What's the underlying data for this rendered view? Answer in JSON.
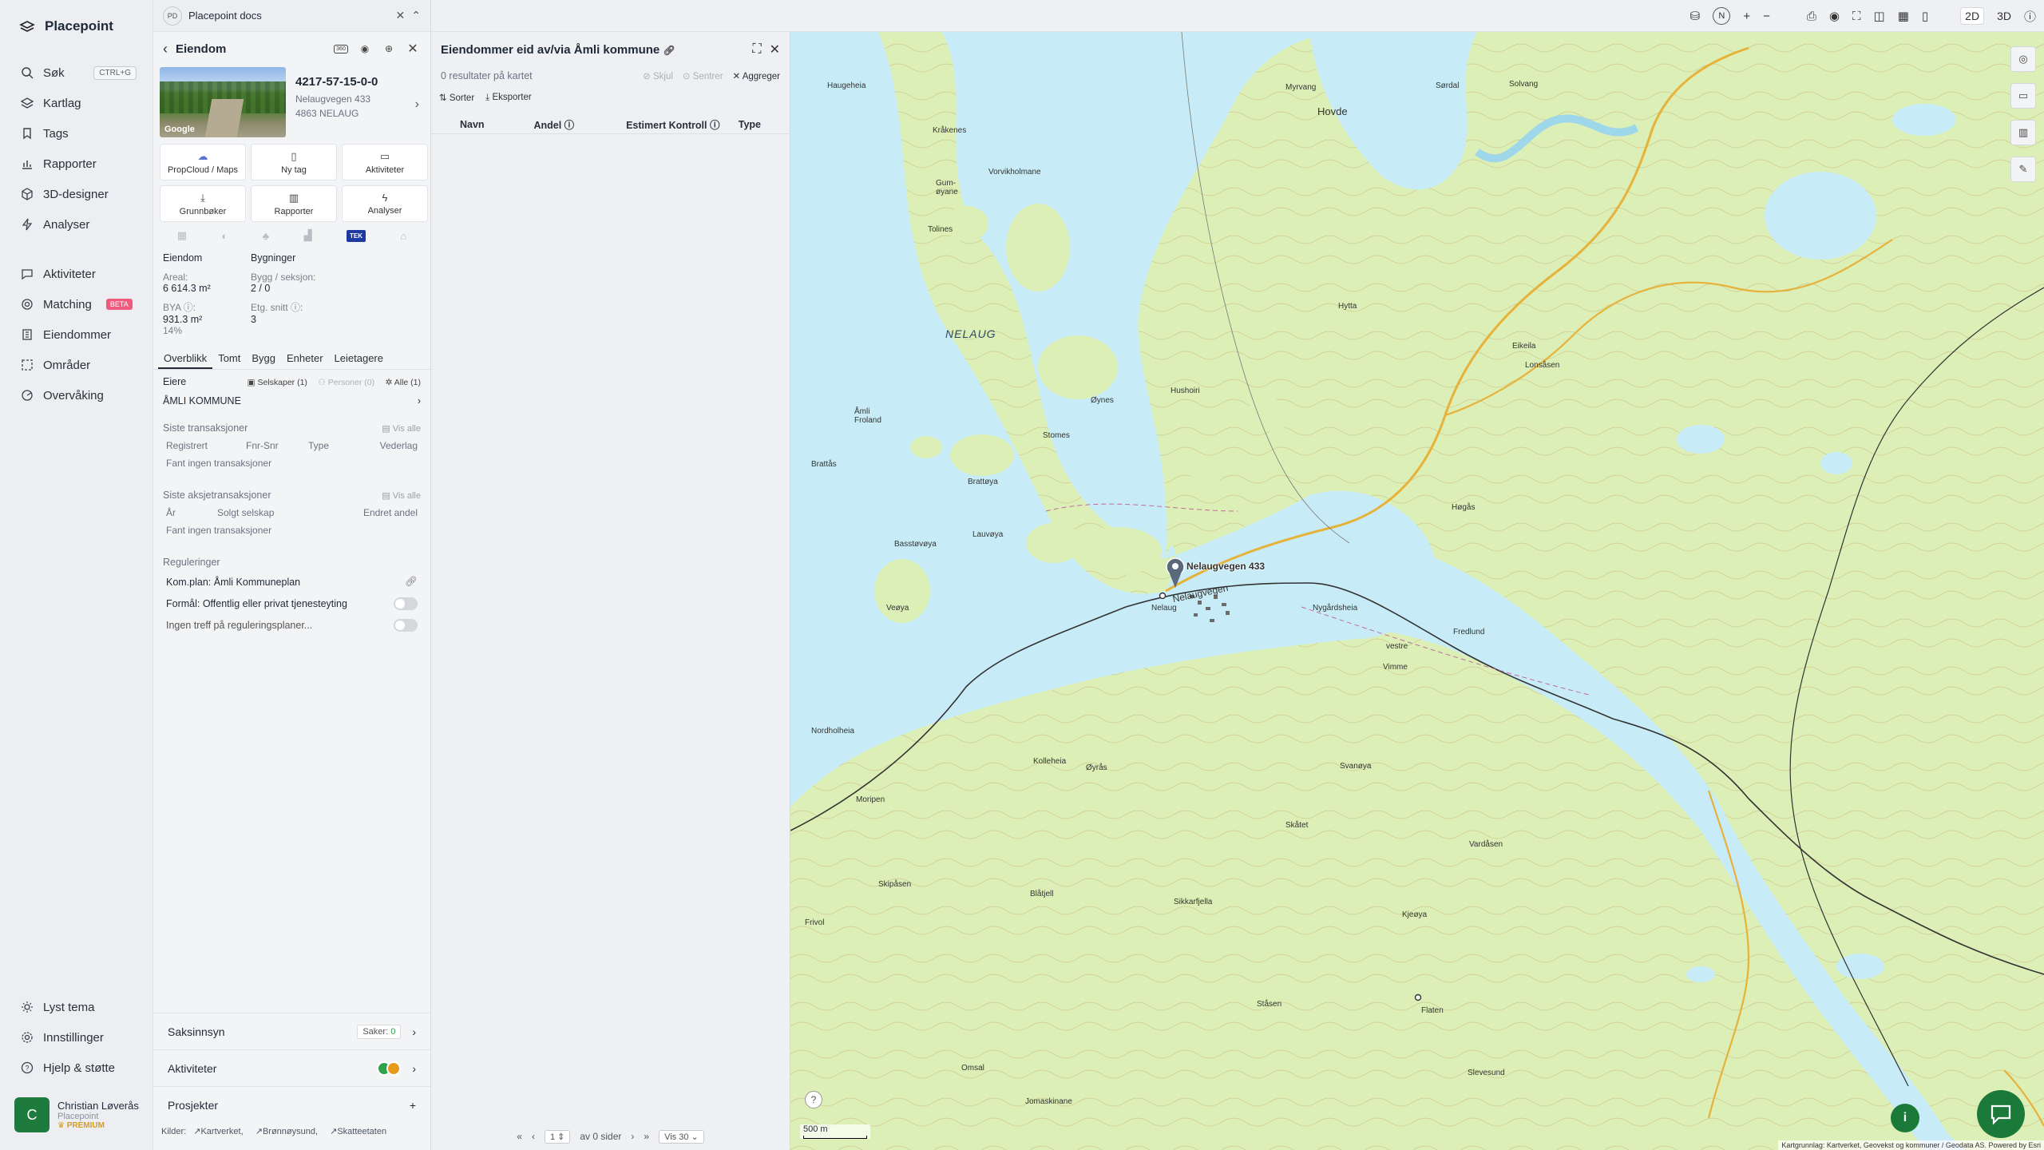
{
  "nav": {
    "brand": "Placepoint",
    "items": [
      {
        "label": "Søk",
        "shortcut": "CTRL+G"
      },
      {
        "label": "Kartlag"
      },
      {
        "label": "Tags"
      },
      {
        "label": "Rapporter"
      },
      {
        "label": "3D-designer"
      },
      {
        "label": "Analyser"
      }
    ],
    "items2": [
      {
        "label": "Aktiviteter"
      },
      {
        "label": "Matching",
        "badge": "BETA"
      },
      {
        "label": "Eiendommer"
      },
      {
        "label": "Områder"
      },
      {
        "label": "Overvåking"
      }
    ],
    "bottom": [
      {
        "label": "Lyst tema"
      },
      {
        "label": "Innstillinger"
      },
      {
        "label": "Hjelp & støtte"
      }
    ],
    "user": {
      "initial": "C",
      "name": "Christian Løverås",
      "org": "Placepoint",
      "tier": "PREMIUM"
    }
  },
  "panel1": {
    "doc_badge": "PD",
    "doc_title": "Placepoint docs",
    "heading": "Eiendom",
    "badge_360": "360",
    "property": {
      "id": "4217-57-15-0-0",
      "street": "Nelaugvegen 433",
      "postal": "4863 NELAUG",
      "image_credit": "Google"
    },
    "tiles": [
      {
        "label": "PropCloud / Maps"
      },
      {
        "label": "Ny tag"
      },
      {
        "label": "Aktiviteter"
      },
      {
        "label": "Grunnbøker"
      },
      {
        "label": "Rapporter"
      },
      {
        "label": "Analyser"
      }
    ],
    "layer_tek": "TEK",
    "facts": {
      "col1_title": "Eiendom",
      "col2_title": "Bygninger",
      "areal_label": "Areal:",
      "areal_value": "6 614.3 m²",
      "bygg_label": "Bygg / seksjon:",
      "bygg_value": "2 / 0",
      "bya_label": "BYA ⓘ:",
      "bya_value": "931.3 m²",
      "bya_pct": "14%",
      "etg_label": "Etg. snitt ⓘ:",
      "etg_value": "3"
    },
    "tabs": [
      "Overblikk",
      "Tomt",
      "Bygg",
      "Enheter",
      "Leietagere"
    ],
    "owners": {
      "label": "Eiere",
      "companies": "Selskaper (1)",
      "persons": "Personer (0)",
      "all": "Alle (1)",
      "owner_name": "ÅMLI KOMMUNE"
    },
    "transactions": {
      "title": "Siste transaksjoner",
      "view_all": "Vis alle",
      "cols": [
        "Registrert",
        "Fnr-Snr",
        "Type",
        "Vederlag"
      ],
      "empty": "Fant ingen transaksjoner"
    },
    "share_transactions": {
      "title": "Siste aksjetransaksjoner",
      "view_all": "Vis alle",
      "cols": [
        "År",
        "Solgt selskap",
        "Endret andel"
      ],
      "empty": "Fant ingen transaksjoner"
    },
    "regulations": {
      "title": "Reguleringer",
      "plan": "Kom.plan: Åmli Kommuneplan",
      "purpose": "Formål: Offentlig eller privat tjenesteyting",
      "none": "Ingen treff på reguleringsplaner..."
    },
    "accordions": {
      "saksinnsyn": "Saksinnsyn",
      "saker_label": "Saker:",
      "saker_count": "0",
      "aktiviteter": "Aktiviteter",
      "prosjekter": "Prosjekter"
    },
    "sources": {
      "label": "Kilder:",
      "items": [
        "Kartverket,",
        "Brønnøysund,",
        "Skatteetaten"
      ]
    }
  },
  "panel2": {
    "title": "Eiendommer eid av/via Åmli kommune",
    "results": "0 resultater på kartet",
    "hide": "Skjul",
    "center": "Sentrer",
    "aggregate": "Aggreger",
    "sort": "Sorter",
    "export": "Eksporter",
    "columns": [
      "Navn",
      "Andel ⓘ",
      "Estimert Kontroll ⓘ",
      "Type"
    ],
    "pager": {
      "page": "1",
      "of": "av 0 sider",
      "per_page": "Vis 30"
    }
  },
  "map": {
    "view_2d": "2D",
    "view_3d": "3D",
    "compass": "N",
    "scale": "500 m",
    "marker_label": "Nelaugvegen 433",
    "attribution": "Kartgrunnlag: Kartverket, Geovekst og kommuner / Geodata AS. Powered by Esri",
    "labels": {
      "nelaug_lake": "NELAUG",
      "hovde": "Hovde",
      "nelaug": "Nelaug",
      "nelaugvegen": "Nelaugvegen",
      "stomes": "Stomes",
      "brattoya": "Brattøya",
      "lauvoya": "Lauvøya",
      "basstovoya": "Basstøvøya",
      "veoya": "Veøya",
      "oynes": "Øynes",
      "gumoyane": "Gum-øyane",
      "tolines": "Tolines",
      "krakenes": "Kråkenes",
      "vorvikholmane": "Vorvikholmane",
      "haugeheia": "Haugeheia",
      "amli_froland": "Åmli Froland",
      "brattas": "Brattås",
      "nordholheia": "Nordholheia",
      "moripen": "Moripen",
      "skipasen": "Skipåsen",
      "frivol": "Frivol",
      "kolleheia": "Kolleheia",
      "oyras": "Øyrås",
      "sikkarfjella": "Sikkarfjella",
      "blatjell": "Blåtjell",
      "skatet": "Skåtet",
      "svanoya": "Svanøya",
      "hytta": "Hytta",
      "eikeila": "Eikeila",
      "myrvang": "Myrvang",
      "sordal": "Sørdal",
      "solvang": "Solvang",
      "hogas": "Høgås",
      "fredlund": "Fredlund",
      "vardasen": "Vardåsen",
      "flaten": "Flaten",
      "kjeoya": "Kjeøya",
      "stasen": "Ståsen",
      "omsal": "Omsal",
      "jomaskinane": "Jomaskinane",
      "slevesund": "Slevesund",
      "lonsasen": "Lonsåsen",
      "vestre": "vestre",
      "vimme": "Vimme",
      "nygardsheia": "Nygårdsheia",
      "hushoiri": "Hushoiri"
    }
  },
  "colors": {
    "accent": "#1b7a3a",
    "water": "#c8ecf7",
    "land": "#dcefb6",
    "beta": "#f05a7e"
  }
}
